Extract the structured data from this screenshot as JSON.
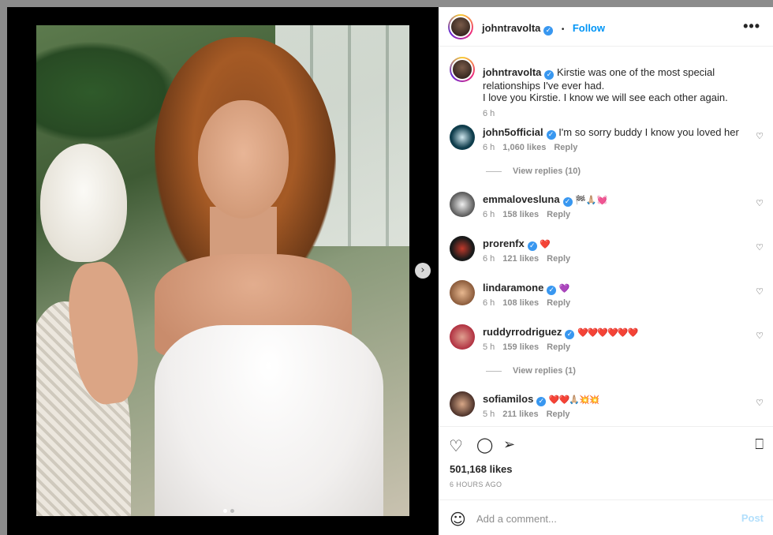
{
  "post": {
    "dots_count": 2,
    "active_dot": 0
  },
  "header": {
    "username": "johntravolta",
    "separator": "•",
    "follow_label": "Follow",
    "more_icon": "more-horizontal-icon",
    "more_label": "•••"
  },
  "caption": {
    "username": "johntravolta",
    "text_line1": "Kirstie was one of the most special",
    "text_line2": "relationships I've ever had.",
    "text_line3": "I love you Kirstie. I know we will see each other again.",
    "time": "6 h"
  },
  "comments": [
    {
      "username": "john5official",
      "text": "I'm so sorry buddy I know you loved her",
      "time": "6 h",
      "likes": "1,060 likes",
      "reply": "Reply",
      "view_replies": "View replies (10)"
    },
    {
      "username": "emmalovesluna",
      "text": "🏁🙏🏼💓",
      "time": "6 h",
      "likes": "158 likes",
      "reply": "Reply",
      "view_replies": ""
    },
    {
      "username": "prorenfx",
      "text": "❤️",
      "time": "6 h",
      "likes": "121 likes",
      "reply": "Reply",
      "view_replies": ""
    },
    {
      "username": "lindaramone",
      "text": "💜",
      "time": "6 h",
      "likes": "108 likes",
      "reply": "Reply",
      "view_replies": ""
    },
    {
      "username": "ruddyrrodriguez",
      "text": "❤️❤️❤️❤️❤️❤️",
      "time": "5 h",
      "likes": "159 likes",
      "reply": "Reply",
      "view_replies": "View replies (1)"
    },
    {
      "username": "sofiamilos",
      "text": "❤️❤️🙏🏼💥💥",
      "time": "5 h",
      "likes": "211 likes",
      "reply": "Reply",
      "view_replies": ""
    }
  ],
  "actions": {
    "like_icon": "heart-icon",
    "comment_icon": "comment-icon",
    "share_icon": "share-icon",
    "save_icon": "bookmark-icon",
    "likes": "501,168 likes",
    "time_ago": "6 HOURS AGO"
  },
  "add_comment": {
    "placeholder": "Add a comment...",
    "post_label": "Post",
    "emoji_icon": "emoji-icon"
  },
  "colors": {
    "accent": "#0095f6",
    "verified": "#3897f0",
    "heart_red": "#ed4956",
    "muted": "#8e8e8e"
  }
}
